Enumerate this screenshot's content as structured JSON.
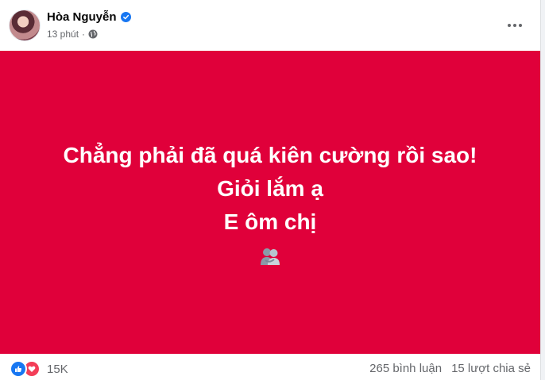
{
  "post": {
    "author": "Hòa Nguyễn",
    "time": "13 phút",
    "separator": "·",
    "lines": [
      "Chẳng phải đã quá kiên cường rồi sao!",
      "Giỏi lắm ạ",
      "E ôm chị"
    ],
    "emoji_icon": "people-hugging-icon",
    "background_color": "#e0003a",
    "text_color": "#ffffff"
  },
  "footer": {
    "reaction_count": "15K",
    "comments": "265 bình luận",
    "shares": "15 lượt chia sẻ",
    "reactions": [
      "like-icon",
      "love-icon"
    ]
  }
}
